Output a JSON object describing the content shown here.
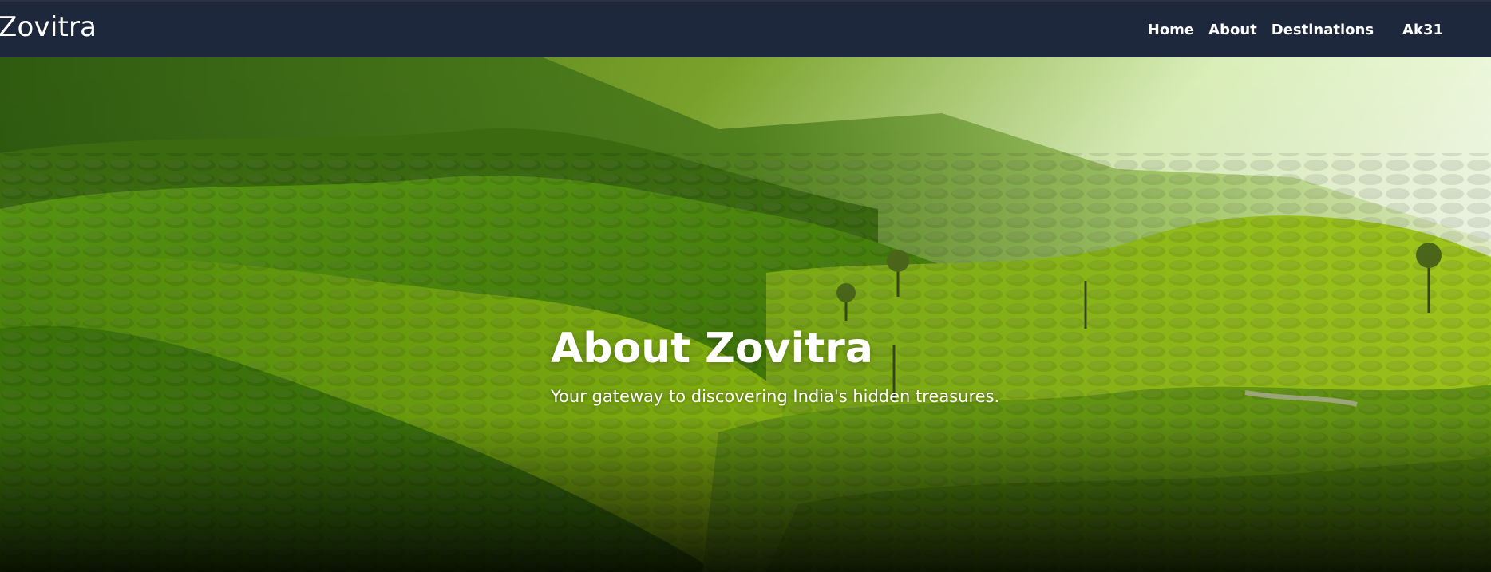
{
  "navbar": {
    "brand": "Zovitra",
    "links": [
      {
        "label": "Home"
      },
      {
        "label": "About"
      },
      {
        "label": "Destinations"
      }
    ],
    "user": "Ak31",
    "background_color": "#1e283d"
  },
  "hero": {
    "title": "About Zovitra",
    "subtitle": "Your gateway to discovering India's hidden treasures.",
    "image_subject": "tea-plantation-hills"
  }
}
